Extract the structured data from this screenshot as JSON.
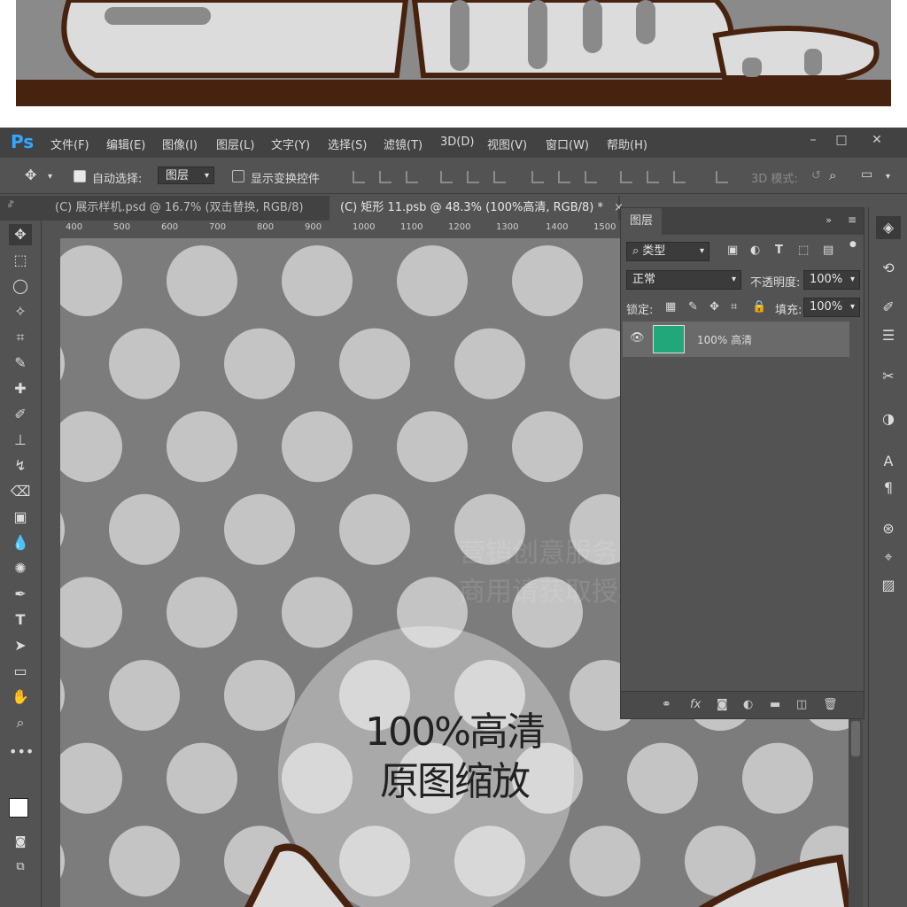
{
  "app": {
    "name": "Ps"
  },
  "menu": [
    "文件(F)",
    "编辑(E)",
    "图像(I)",
    "图层(L)",
    "文字(Y)",
    "选择(S)",
    "滤镜(T)",
    "3D(D)",
    "视图(V)",
    "窗口(W)",
    "帮助(H)"
  ],
  "window_controls": {
    "minimize": "–",
    "maximize": "□",
    "close": "✕"
  },
  "options_bar": {
    "auto_select_label": "自动选择:",
    "auto_select_target": "图层",
    "show_transform_label": "显示变换控件",
    "mode_3d_label": "3D 模式:"
  },
  "tabs": [
    {
      "label": "(C) 展示样机.psd @ 16.7% (双击替换, RGB/8)",
      "active": false
    },
    {
      "label": "(C) 矩形 11.psb @ 48.3% (100%高清, RGB/8) *",
      "active": true
    }
  ],
  "ruler_top_labels": [
    "400",
    "500",
    "600",
    "700",
    "800",
    "900",
    "1000",
    "1100",
    "1200",
    "1300",
    "1400",
    "1500"
  ],
  "canvas": {
    "center_text_line1": "100%高清",
    "center_text_line2": "原图缩放",
    "watermark_line1": "营销创意服务与协作平台",
    "watermark_line2": "商用请获取授权"
  },
  "layers_panel": {
    "title": "图层",
    "filter_kind": "类型",
    "blend_mode": "正常",
    "opacity_label": "不透明度:",
    "opacity_value": "100%",
    "lock_label": "锁定:",
    "fill_label": "填充:",
    "fill_value": "100%",
    "layer_name": "100% 高清"
  },
  "colors": {
    "accent": "#31a8ff",
    "layer_thumb": "#22a77a",
    "brown": "#47230f"
  },
  "icons": {
    "move": "move-tool-icon",
    "marquee": "rect-marquee-icon",
    "lasso": "lasso-icon",
    "eye": "eye-icon"
  }
}
